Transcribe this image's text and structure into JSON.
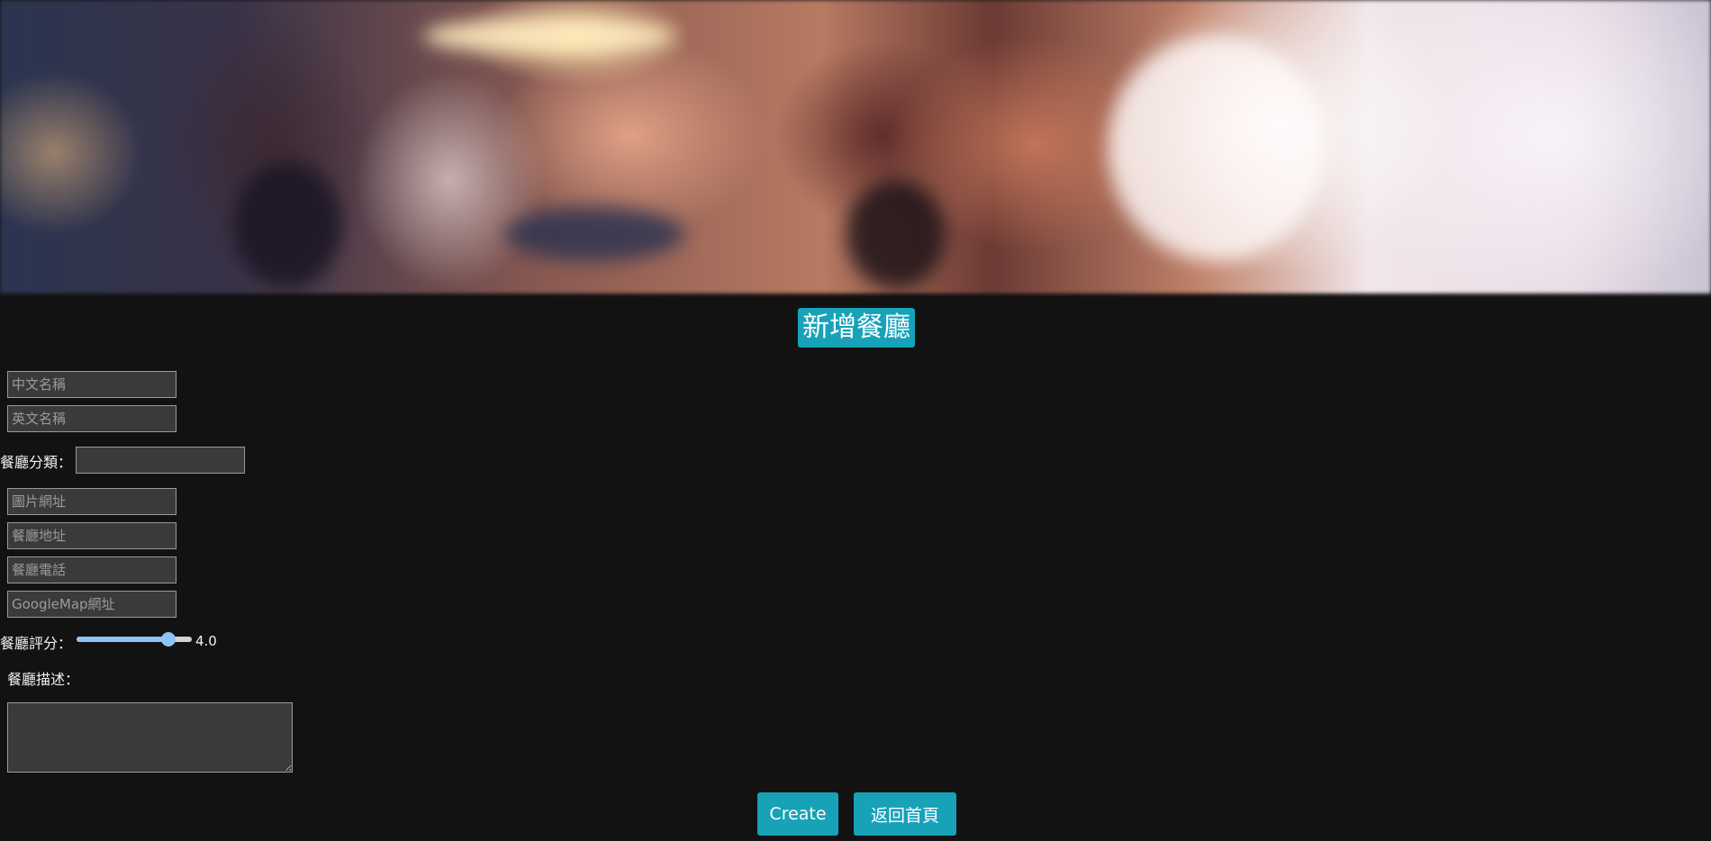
{
  "header": {
    "banner_alt": "",
    "title": "新增餐廳"
  },
  "form": {
    "name_placeholder": "中文名稱",
    "name_en_placeholder": "英文名稱",
    "category_label": "餐廳分類：",
    "category_value": "",
    "image_placeholder": "圖片網址",
    "location_placeholder": "餐廳地址",
    "phone_placeholder": "餐廳電話",
    "google_map_placeholder": "GoogleMap網址",
    "rating_label": "餐廳評分：",
    "rating_value": "4.0",
    "rating_fraction": 0.8,
    "description_label": "餐廳描述：",
    "description_value": ""
  },
  "actions": {
    "create_label": "Create",
    "home_label": "返回首頁"
  },
  "colors": {
    "accent": "#17a2b8",
    "background": "#121212",
    "field_bg": "#3a3a3a",
    "slider": "#8ec3f5"
  }
}
